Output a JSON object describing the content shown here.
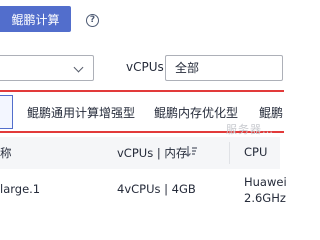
{
  "arch_tabs": {
    "active_label": "鲲鹏计算"
  },
  "filters": {
    "left_select_value": "",
    "vcpus_label": "vCPUs",
    "vcpus_value": "全部"
  },
  "flavor_tabs": [
    {
      "label": ""
    },
    {
      "label": "鲲鹏通用计算增强型"
    },
    {
      "label": "鲲鹏内存优化型"
    },
    {
      "label": "鲲鹏"
    }
  ],
  "watermark": "服务器…",
  "table": {
    "headers": {
      "name": "称",
      "vcpus_memory": "vCPUs | 内存",
      "cpu": "CPU"
    },
    "rows": [
      {
        "name": "large.1",
        "vcpus_memory": "4vCPUs | 4GB",
        "cpu_line1": "Huawei",
        "cpu_line2": "2.6GHz"
      }
    ]
  },
  "colors": {
    "accent": "#526ecc",
    "highlight_frame": "#e23a3a",
    "header_bg": "#f5f6f8"
  },
  "icons": [
    "help-icon",
    "chevron-down-icon",
    "sort-icon"
  ]
}
